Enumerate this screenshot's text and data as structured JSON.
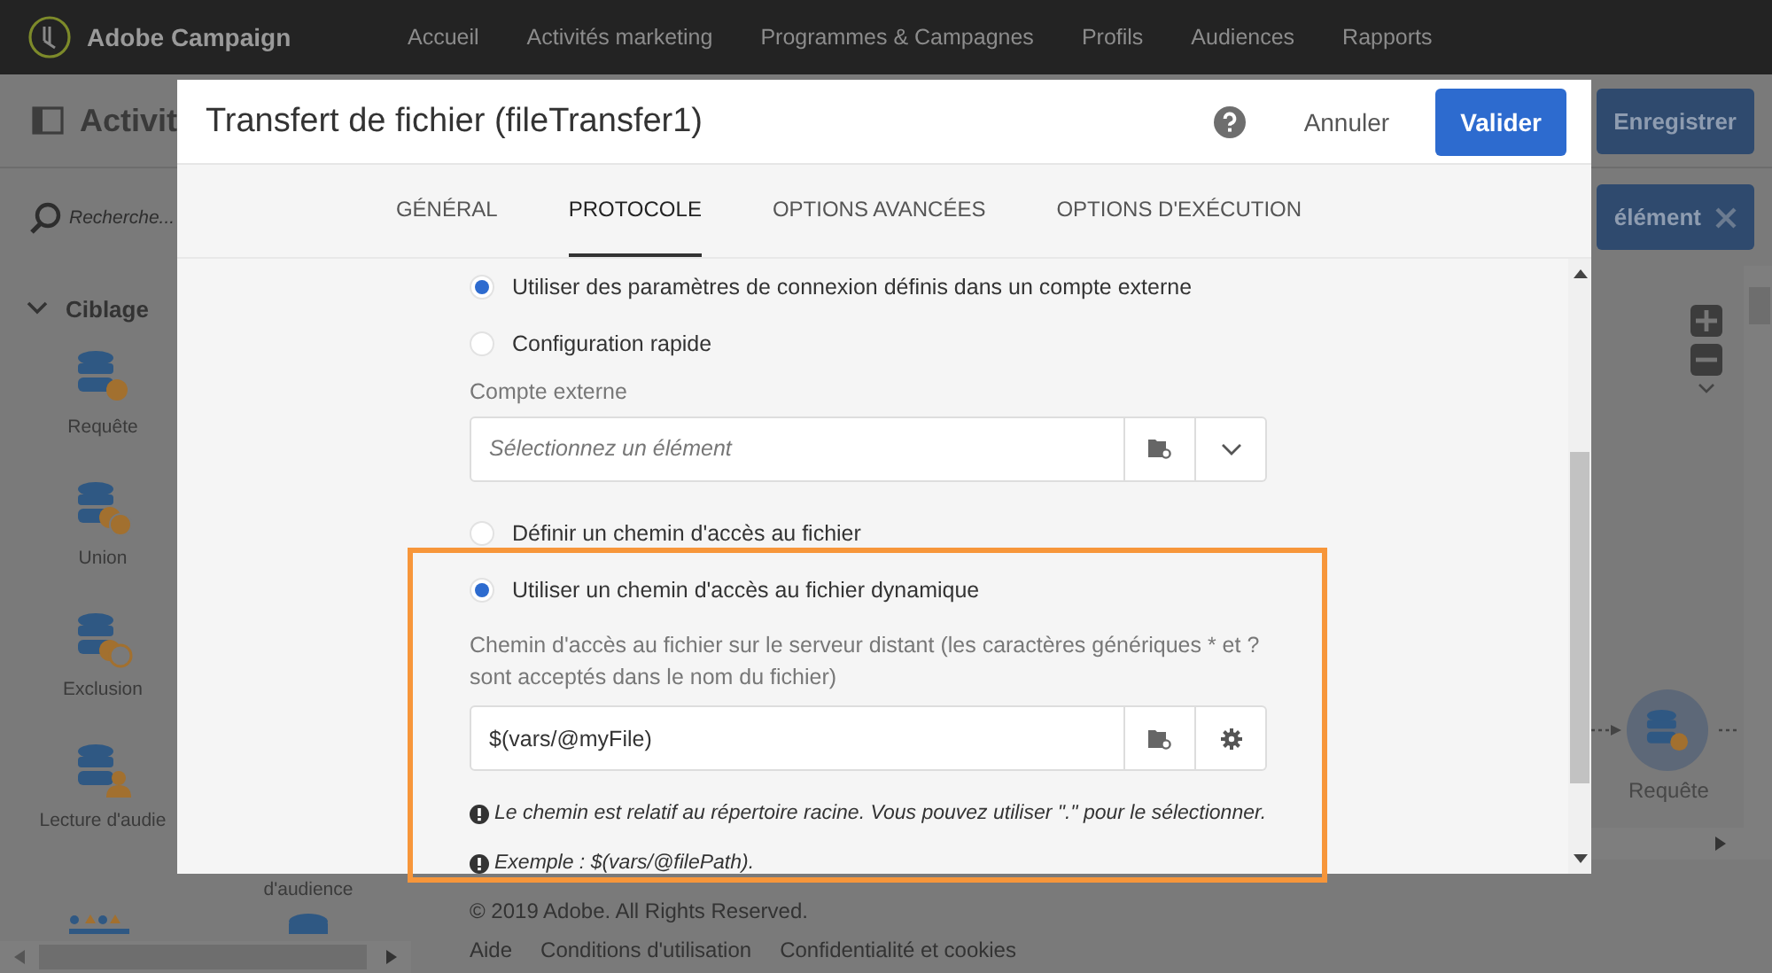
{
  "app_bar": {
    "brand": "Adobe Campaign",
    "nav": [
      {
        "label": "Accueil"
      },
      {
        "label": "Activités marketing"
      },
      {
        "label": "Programmes & Campagnes"
      },
      {
        "label": "Profils"
      },
      {
        "label": "Audiences"
      },
      {
        "label": "Rapports"
      }
    ]
  },
  "page": {
    "title": "Activit",
    "save_button": "Enregistrer",
    "search": {
      "placeholder": "Recherche..."
    },
    "element_button": "élément"
  },
  "palette": {
    "section": {
      "label": "Ciblage",
      "expanded": true
    },
    "rows": [
      [
        {
          "kind": "query",
          "label": "Requête"
        }
      ],
      [
        {
          "kind": "union",
          "label": "Union"
        }
      ],
      [
        {
          "kind": "exclusion",
          "label": "Exclusion"
        }
      ],
      [
        {
          "kind": "audience",
          "label": "Lecture d'audie"
        },
        {
          "kind": "hidden",
          "label": "d'audience"
        }
      ],
      [
        {
          "kind": "segment"
        },
        {
          "kind": "database"
        }
      ]
    ]
  },
  "canvas": {
    "node": {
      "label": "Requête"
    }
  },
  "footer": {
    "copyright": "© 2019 Adobe. All Rights Reserved.",
    "links": [
      "Aide",
      "Conditions d'utilisation",
      "Confidentialité et cookies"
    ]
  },
  "dialog": {
    "title": "Transfert de fichier (fileTransfer1)",
    "cancel": "Annuler",
    "confirm": "Valider",
    "tabs": [
      {
        "label": "GÉNÉRAL",
        "selected": false
      },
      {
        "label": "PROTOCOLE",
        "selected": true
      },
      {
        "label": "OPTIONS AVANCÉES",
        "selected": false
      },
      {
        "label": "OPTIONS D'EXÉCUTION",
        "selected": false
      }
    ],
    "connection_options": [
      {
        "label": "Utiliser des paramètres de connexion définis dans un compte externe",
        "selected": true
      },
      {
        "label": "Configuration rapide",
        "selected": false
      }
    ],
    "external_account": {
      "label": "Compte externe",
      "placeholder": "Sélectionnez un élément"
    },
    "path_options": [
      {
        "label": "Définir un chemin d'accès au fichier",
        "selected": false
      },
      {
        "label": "Utiliser un chemin d'accès au fichier dynamique",
        "selected": true
      }
    ],
    "remote_path": {
      "label": "Chemin d'accès au fichier sur le serveur distant (les caractères génériques * et ? sont acceptés dans le nom du fichier)",
      "value": "$(vars/@myFile)"
    },
    "notes": [
      "Le chemin est relatif au répertoire racine. Vous pouvez utiliser \".\" pour le sélectionner.",
      "Exemple : $(vars/@filePath)."
    ]
  }
}
